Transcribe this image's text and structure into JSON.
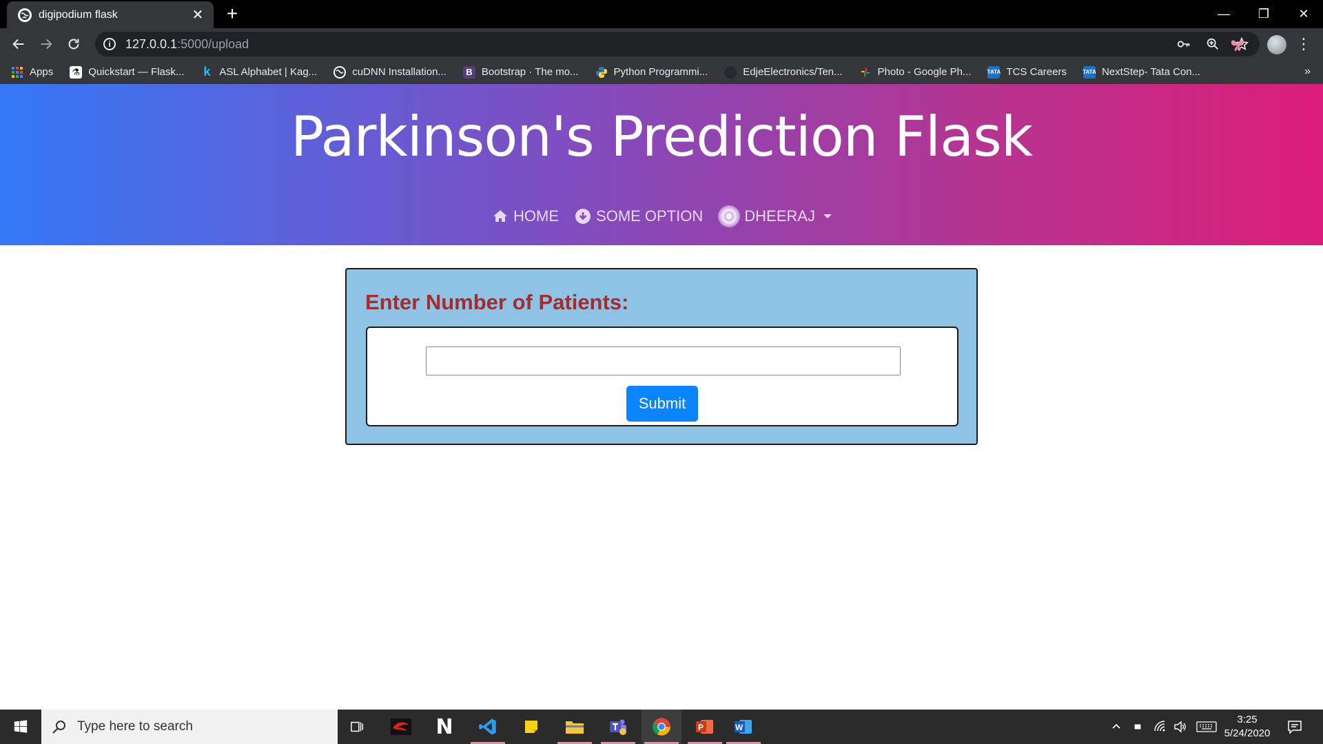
{
  "browser": {
    "tab_title": "digipodium flask",
    "url_host": "127.0.0.1",
    "url_path": ":5000/upload",
    "bookmarks": [
      {
        "label": "Apps",
        "icon": "apps-grid-icon"
      },
      {
        "label": "Quickstart — Flask...",
        "icon": "flask-icon"
      },
      {
        "label": "ASL Alphabet | Kag...",
        "icon": "kaggle-icon"
      },
      {
        "label": "cuDNN Installation...",
        "icon": "globe-icon"
      },
      {
        "label": "Bootstrap · The mo...",
        "icon": "bootstrap-icon"
      },
      {
        "label": "Python Programmi...",
        "icon": "python-icon"
      },
      {
        "label": "EdjeElectronics/Ten...",
        "icon": "github-icon"
      },
      {
        "label": "Photo - Google Ph...",
        "icon": "google-photos-icon"
      },
      {
        "label": "TCS Careers",
        "icon": "tata-icon"
      },
      {
        "label": "NextStep- Tata Con...",
        "icon": "tata-icon"
      }
    ],
    "more_bookmarks": "»"
  },
  "page": {
    "title": "Parkinson's Prediction Flask",
    "nav": {
      "home": "HOME",
      "option": "SOME OPTION",
      "user": "DHEERAJ"
    },
    "form": {
      "heading": "Enter Number of Patients:",
      "input_value": "",
      "submit_label": "Submit"
    }
  },
  "taskbar": {
    "search_placeholder": "Type here to search",
    "time": "3:25",
    "date": "5/24/2020"
  },
  "colors": {
    "hero_gradient_start": "#3478f6",
    "hero_gradient_end": "#dc1e79",
    "card_bg": "#8ec3e6",
    "heading_color": "#a62b2b",
    "submit_bg": "#0a84ff"
  }
}
